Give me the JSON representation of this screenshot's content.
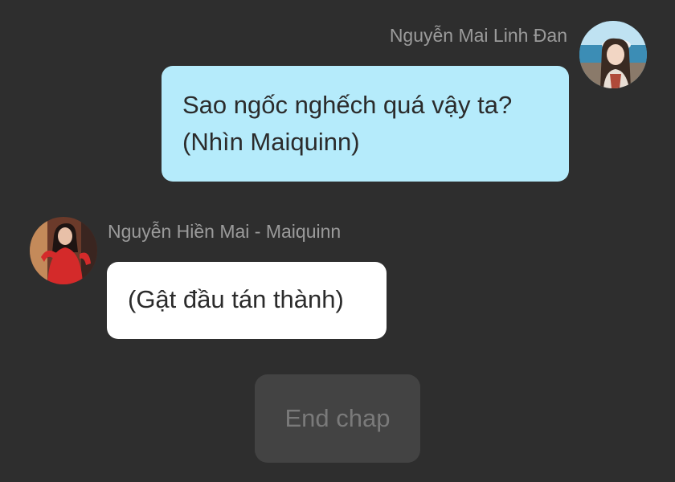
{
  "messages": [
    {
      "sender": "Nguyễn Mai Linh Đan",
      "side": "right",
      "lines": [
        "Sao ngốc nghếch quá vậy ta?",
        "(Nhìn Maiquinn)"
      ],
      "bubble_color": "#b5ebfb"
    },
    {
      "sender": "Nguyễn Hiền Mai - Maiquinn",
      "side": "left",
      "lines": [
        "(Gật đầu tán thành)"
      ],
      "bubble_color": "#ffffff"
    }
  ],
  "end_button": {
    "label": "End chap"
  },
  "colors": {
    "background": "#2e2e2e",
    "name_text": "#9b9b9b",
    "button_bg": "#434343",
    "button_text": "#7a7a7a"
  }
}
